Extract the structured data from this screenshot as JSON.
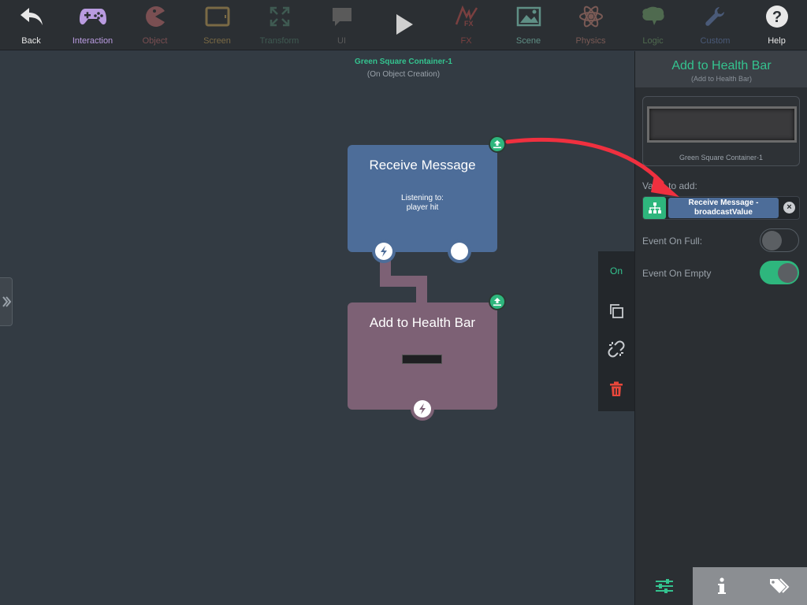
{
  "toolbar": {
    "items": [
      {
        "label": "Back",
        "icon": "back-arrow-icon",
        "color": "#e8e8e8"
      },
      {
        "label": "Interaction",
        "icon": "gamepad-icon",
        "color": "#b99be0"
      },
      {
        "label": "Object",
        "icon": "pacman-icon",
        "color": "#7a4f52"
      },
      {
        "label": "Screen",
        "icon": "tablet-icon",
        "color": "#7a6a45"
      },
      {
        "label": "Transform",
        "icon": "expand-arrows-icon",
        "color": "#3f5a52"
      },
      {
        "label": "UI",
        "icon": "speech-bubble-icon",
        "color": "#5a5a5a"
      },
      {
        "label": "",
        "icon": "play-icon",
        "color": "#d0d0d0"
      },
      {
        "label": "FX",
        "icon": "fx-icon",
        "color": "#7a4040"
      },
      {
        "label": "Scene",
        "icon": "picture-icon",
        "color": "#5f8f85"
      },
      {
        "label": "Physics",
        "icon": "atom-icon",
        "color": "#7a5a55"
      },
      {
        "label": "Logic",
        "icon": "brain-icon",
        "color": "#4f6a4f"
      },
      {
        "label": "Custom",
        "icon": "wrench-icon",
        "color": "#4a5a78"
      },
      {
        "label": "Help",
        "icon": "question-icon",
        "color": "#e8e8e8"
      }
    ]
  },
  "canvas": {
    "context_title": "Green Square Container-1",
    "context_sub": "(On Object Creation)",
    "block1": {
      "title": "Receive Message",
      "line1": "Listening to:",
      "line2": "player hit"
    },
    "block2": {
      "title": "Add to Health Bar"
    },
    "block_tools": {
      "on_label": "On"
    }
  },
  "panel": {
    "title": "Add to Health Bar",
    "subtitle": "(Add to Health Bar)",
    "preview_label": "Green Square Container-1",
    "value_label": "Value to add:",
    "value_line1": "Receive Message -",
    "value_line2": "broadcastValue",
    "event_full_label": "Event On Full:",
    "event_full_on": false,
    "event_empty_label": "Event On Empty",
    "event_empty_on": true
  },
  "colors": {
    "accent_green": "#34c38f",
    "block_blue": "#4d6d99",
    "block_mauve": "#7d6175",
    "arrow_red": "#f0303f"
  }
}
